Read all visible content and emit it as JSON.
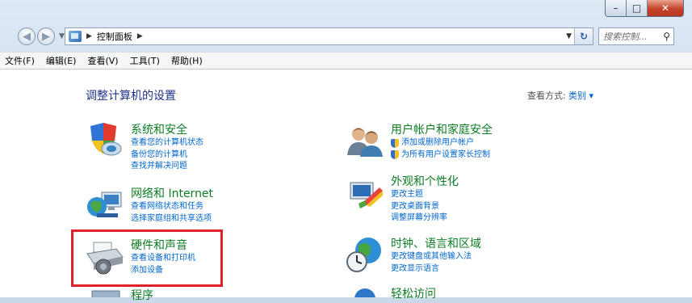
{
  "window": {
    "caption_buttons": [
      "–",
      "□",
      "✕"
    ]
  },
  "address": {
    "path": [
      "控制面板"
    ]
  },
  "search": {
    "placeholder": "搜索控制..."
  },
  "menu": [
    "文件(F)",
    "编辑(E)",
    "查看(V)",
    "工具(T)",
    "帮助(H)"
  ],
  "main": {
    "heading": "调整计算机的设置",
    "view_by_label": "查看方式:",
    "view_by_value": "类别 ▾",
    "categories": [
      {
        "title": "系统和安全",
        "links": [
          "查看您的计算机状态",
          "备份您的计算机",
          "查找并解决问题"
        ],
        "icon": "shield-computer-icon"
      },
      {
        "title": "网络和 Internet",
        "links": [
          "查看网络状态和任务",
          "选择家庭组和共享选项"
        ],
        "icon": "network-globe-icon"
      },
      {
        "title": "硬件和声音",
        "links": [
          "查看设备和打印机",
          "添加设备"
        ],
        "icon": "printer-icon"
      },
      {
        "title": "程序",
        "links": [],
        "icon": "programs-icon"
      },
      {
        "title": "用户帐户和家庭安全",
        "links": [
          "添加或删除用户帐户",
          "为所有用户设置家长控制"
        ],
        "icon": "users-icon"
      },
      {
        "title": "外观和个性化",
        "links": [
          "更改主题",
          "更改桌面背景",
          "调整屏幕分辨率"
        ],
        "icon": "appearance-icon"
      },
      {
        "title": "时钟、语言和区域",
        "links": [
          "更改键盘或其他输入法",
          "更改显示语言"
        ],
        "icon": "clock-globe-icon"
      },
      {
        "title": "轻松访问",
        "links": [],
        "icon": "ease-of-access-icon"
      }
    ]
  },
  "colors": {
    "highlight": "#e1212a",
    "category_title": "#0d7d23",
    "link": "#0066cc",
    "heading": "#1e3287"
  }
}
